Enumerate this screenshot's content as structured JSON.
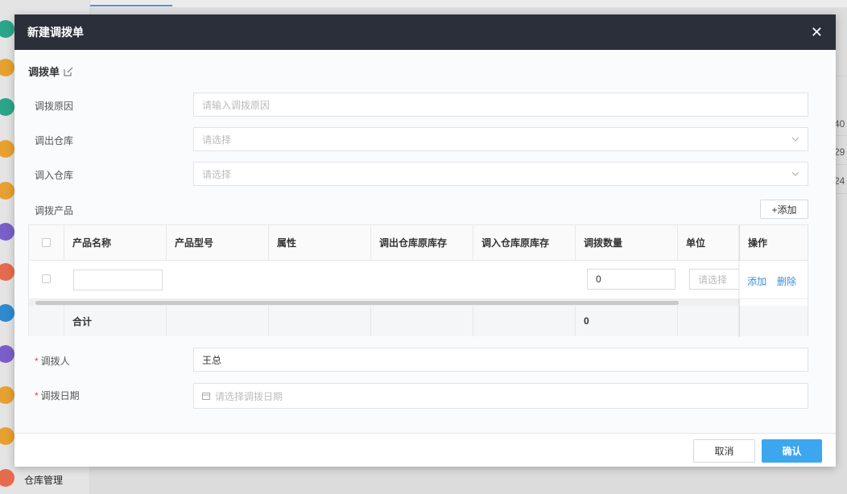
{
  "background": {
    "sidebar_circle_colors": [
      "#2ba58a",
      "#e6a130",
      "#2ba58a",
      "#e6a130",
      "#e6a130",
      "#7a5fc9",
      "#e66a4f",
      "#2f8ad0",
      "#7a5fc9",
      "#e6a130",
      "#e6a130",
      "#e66a4f"
    ],
    "sidebar_last_label": "仓库管理",
    "right_numbers": [
      "40",
      "29",
      "24"
    ]
  },
  "modal": {
    "title": "新建调拨单",
    "close_icon": "close-icon",
    "section_title": "调拨单",
    "fields": {
      "reason_label": "调拨原因",
      "reason_placeholder": "请输入调拨原因",
      "out_label": "调出仓库",
      "out_placeholder": "请选择",
      "in_label": "调入仓库",
      "in_placeholder": "请选择",
      "products_label": "调拨产品",
      "person_label": "调拨人",
      "person_value": "王总",
      "date_label": "调拨日期",
      "date_placeholder": "请选择调拨日期"
    },
    "add_button": "+添加",
    "table": {
      "headers": [
        "产品名称",
        "产品型号",
        "属性",
        "调出仓库原库存",
        "调入仓库原库存",
        "调拨数量",
        "单位",
        "操作"
      ],
      "row": {
        "quantity_value": "0",
        "unit_placeholder": "请选择",
        "action_add": "添加",
        "action_delete": "删除"
      },
      "footer": {
        "label": "合计",
        "total_quantity": "0"
      }
    },
    "footer": {
      "cancel": "取消",
      "confirm": "确认"
    },
    "accent_color": "#3da6f0",
    "header_color": "#2b2f3a",
    "required_color": "#e2463b"
  }
}
